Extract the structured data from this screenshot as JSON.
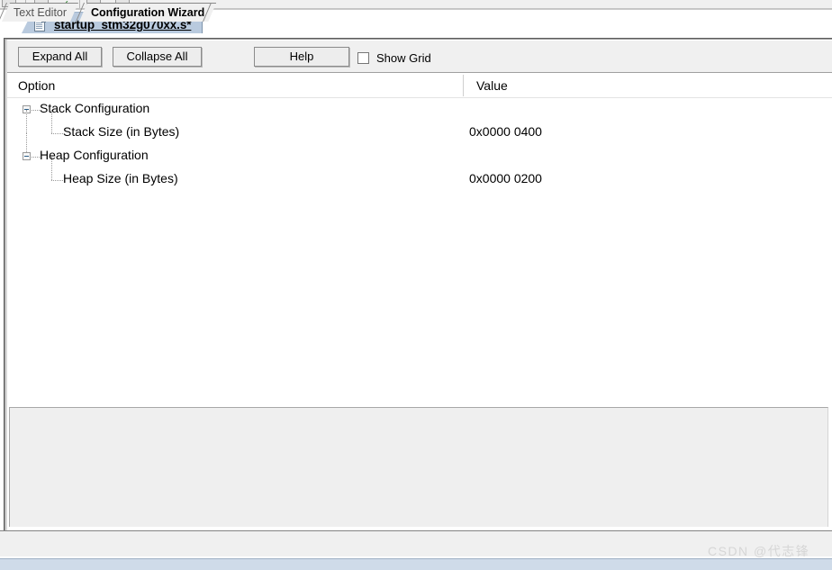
{
  "window": {
    "toolbar_icons": [
      {
        "name": "save-icon",
        "glyph": "■"
      },
      {
        "name": "document-icon",
        "glyph": "▭"
      },
      {
        "name": "checkmark-icon",
        "glyph": "✓"
      },
      {
        "name": "build-icon",
        "glyph": "■"
      },
      {
        "name": "target-options-icon",
        "glyph": "▦"
      }
    ]
  },
  "document_tab": {
    "label": "startup_stm32g070xx.s*",
    "icon": "file-icon",
    "active": true
  },
  "toolbar": {
    "expand_all_label": "Expand All",
    "collapse_all_label": "Collapse All",
    "help_label": "Help",
    "show_grid_label": "Show Grid",
    "show_grid_checked": false
  },
  "columns": {
    "option_header": "Option",
    "value_header": "Value"
  },
  "tree": {
    "rows": [
      {
        "label": "Stack Configuration",
        "value": "",
        "level": 0,
        "type": "group",
        "expanded": true,
        "expander_glyph": "-"
      },
      {
        "label": "Stack Size (in Bytes)",
        "value": "0x0000 0400",
        "level": 1,
        "type": "item",
        "expanded": false,
        "expander_glyph": ""
      },
      {
        "label": "Heap Configuration",
        "value": "",
        "level": 0,
        "type": "group",
        "expanded": true,
        "expander_glyph": "-"
      },
      {
        "label": "Heap Size (in Bytes)",
        "value": "0x0000 0200",
        "level": 1,
        "type": "item",
        "expanded": false,
        "expander_glyph": ""
      }
    ]
  },
  "bottom_tabs": {
    "items": [
      {
        "label": "Text Editor",
        "active": false
      },
      {
        "label": "Configuration Wizard",
        "active": true
      }
    ]
  },
  "watermark": {
    "text": "CSDN @代志锋"
  },
  "colors": {
    "tab_active_bg": "#b9cade",
    "panel_bg": "#efefef",
    "status_bar_bg": "#cfdbe9",
    "expander_line": "#2b5d86",
    "watermark": "#d6d6d6"
  }
}
